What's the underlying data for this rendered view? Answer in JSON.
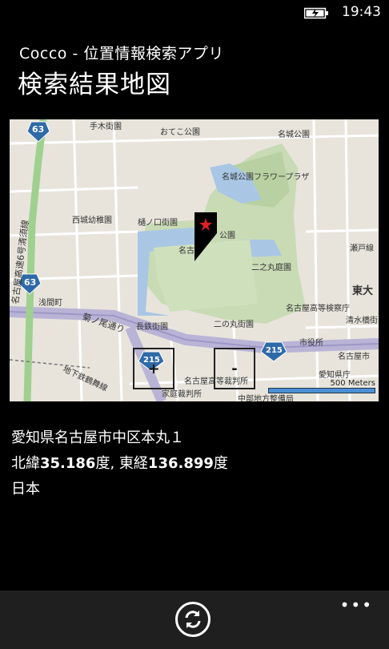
{
  "status": {
    "time": "19:43",
    "battery_icon": "battery-charging-icon"
  },
  "header": {
    "app_name": "Cocco  -  位置情報検索アプリ",
    "title": "検索結果地図"
  },
  "map": {
    "labels": {
      "route63a": "63",
      "route63b": "63",
      "route215a": "215",
      "route215b": "215",
      "tennoki": "手木街園",
      "oteko": "おてこ公園",
      "meijo": "名城公園",
      "flower": "名城公園フラワープラザ",
      "nishiyochien": "西城幼稚園",
      "hinoki": "樋ノ口街園",
      "koen": "公園",
      "nago": "名古",
      "ninomaru": "二之丸庭園",
      "senmacho": "浅間町",
      "koto": "名古屋高等検察庁",
      "shimizu": "清水橋街",
      "seto": "瀬戸線",
      "higashi": "東大",
      "chokaku": "長鉄街園",
      "ninomaru2": "二の丸街園",
      "shiyakusho": "市役所",
      "kikui": "菊ノ尾通り",
      "nagoyashi": "名古屋市",
      "aichi": "愛知県庁",
      "chika": "地下鉄鶴舞線",
      "kosai": "名古屋高等裁判所",
      "kasai": "家庭裁判所",
      "chubu": "中部地方整備局",
      "dori": "名古屋高速6号清須線"
    },
    "zoom_in": "+",
    "zoom_out": "-",
    "scale": "500 Meters",
    "pin_icon": "location-pin-icon"
  },
  "result": {
    "address": "愛知県名古屋市中区本丸１",
    "lat_prefix": "北緯",
    "lat": "35.186",
    "lat_unit": "度, ",
    "lon_prefix": "東経",
    "lon": "136.899",
    "lon_unit": "度",
    "country": "日本"
  },
  "appbar": {
    "refresh_icon": "refresh-icon",
    "more": "•••"
  }
}
